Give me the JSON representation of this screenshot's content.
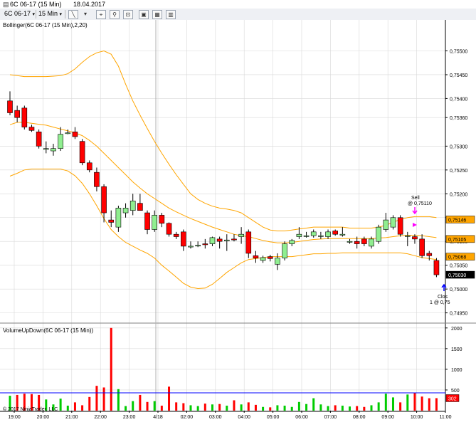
{
  "window": {
    "title": "6C 06-17 (15 Min)",
    "date": "18.04.2017"
  },
  "toolbar": {
    "instrument": "6C 06-17",
    "period": "15 Min"
  },
  "icons": [
    "chevron-down-icon",
    "draw-line-icon",
    "pointer-icon",
    "zoom-icon",
    "properties-icon",
    "data-box-icon",
    "indicators-icon",
    "strategies-icon"
  ],
  "colors": {
    "up": "#90ee90",
    "down": "#ff0000",
    "band": "#ffa500",
    "volume_line": "#0000ff",
    "grid": "#d8d8d8"
  },
  "chart_data": [
    {
      "type": "candlestick",
      "title": "Bollinger(6C 06-17 (15 Min),2,20)",
      "ylim": [
        0.7493,
        0.75565
      ],
      "y_ticks": [
        "0,75500",
        "0,75450",
        "0,75400",
        "0,75360",
        "0,75300",
        "0,75250",
        "0,75200",
        "0,75150",
        "0,75100",
        "0,75050",
        "0,75000",
        "0,74950"
      ],
      "y_tick_values": [
        0.755,
        0.7545,
        0.754,
        0.7536,
        0.753,
        0.7525,
        0.752,
        0.7515,
        0.751,
        0.7505,
        0.75,
        0.7495
      ],
      "x_ticks": [
        "19:00",
        "20:00",
        "21:00",
        "22:00",
        "23:00",
        "4/18",
        "02:00",
        "03:00",
        "04:00",
        "05:00",
        "06:00",
        "07:00",
        "08:00",
        "09:00",
        "10:00",
        "11:00"
      ],
      "candles": [
        {
          "o": 0.75395,
          "h": 0.75415,
          "l": 0.75365,
          "c": 0.7537
        },
        {
          "o": 0.75375,
          "h": 0.75385,
          "l": 0.7535,
          "c": 0.7536
        },
        {
          "o": 0.7538,
          "h": 0.75385,
          "l": 0.75335,
          "c": 0.7534
        },
        {
          "o": 0.7534,
          "h": 0.75345,
          "l": 0.7533,
          "c": 0.75333
        },
        {
          "o": 0.7533,
          "h": 0.75335,
          "l": 0.75295,
          "c": 0.753
        },
        {
          "o": 0.75295,
          "h": 0.7531,
          "l": 0.75285,
          "c": 0.75295
        },
        {
          "o": 0.7529,
          "h": 0.75305,
          "l": 0.7528,
          "c": 0.75295
        },
        {
          "o": 0.75295,
          "h": 0.7534,
          "l": 0.7529,
          "c": 0.75325
        },
        {
          "o": 0.75328,
          "h": 0.75335,
          "l": 0.75325,
          "c": 0.75328
        },
        {
          "o": 0.7533,
          "h": 0.7534,
          "l": 0.75315,
          "c": 0.7532
        },
        {
          "o": 0.7531,
          "h": 0.75315,
          "l": 0.7526,
          "c": 0.75265
        },
        {
          "o": 0.75265,
          "h": 0.7527,
          "l": 0.75245,
          "c": 0.7525
        },
        {
          "o": 0.75245,
          "h": 0.75255,
          "l": 0.75205,
          "c": 0.75215
        },
        {
          "o": 0.75215,
          "h": 0.7522,
          "l": 0.7514,
          "c": 0.7516
        },
        {
          "o": 0.75145,
          "h": 0.75165,
          "l": 0.7513,
          "c": 0.7514
        },
        {
          "o": 0.7513,
          "h": 0.75175,
          "l": 0.7512,
          "c": 0.7517
        },
        {
          "o": 0.7516,
          "h": 0.7518,
          "l": 0.7515,
          "c": 0.7517
        },
        {
          "o": 0.75165,
          "h": 0.752,
          "l": 0.75155,
          "c": 0.75185
        },
        {
          "o": 0.7518,
          "h": 0.752,
          "l": 0.75175,
          "c": 0.75165
        },
        {
          "o": 0.7516,
          "h": 0.75165,
          "l": 0.75115,
          "c": 0.75125
        },
        {
          "o": 0.75125,
          "h": 0.75165,
          "l": 0.7512,
          "c": 0.75155
        },
        {
          "o": 0.75155,
          "h": 0.7516,
          "l": 0.7513,
          "c": 0.75138
        },
        {
          "o": 0.75138,
          "h": 0.7514,
          "l": 0.7511,
          "c": 0.75115
        },
        {
          "o": 0.75115,
          "h": 0.7512,
          "l": 0.75105,
          "c": 0.7511
        },
        {
          "o": 0.7512,
          "h": 0.75125,
          "l": 0.7508,
          "c": 0.7509
        },
        {
          "o": 0.7509,
          "h": 0.751,
          "l": 0.75085,
          "c": 0.7509
        },
        {
          "o": 0.75092,
          "h": 0.751,
          "l": 0.75088,
          "c": 0.75092
        },
        {
          "o": 0.75095,
          "h": 0.75105,
          "l": 0.75085,
          "c": 0.75093
        },
        {
          "o": 0.75095,
          "h": 0.7511,
          "l": 0.7509,
          "c": 0.75108
        },
        {
          "o": 0.75105,
          "h": 0.7511,
          "l": 0.75085,
          "c": 0.751
        },
        {
          "o": 0.75103,
          "h": 0.75115,
          "l": 0.7508,
          "c": 0.75103
        },
        {
          "o": 0.75105,
          "h": 0.75115,
          "l": 0.751,
          "c": 0.75103
        },
        {
          "o": 0.7511,
          "h": 0.7513,
          "l": 0.75095,
          "c": 0.75115
        },
        {
          "o": 0.7512,
          "h": 0.75125,
          "l": 0.75065,
          "c": 0.75075
        },
        {
          "o": 0.7507,
          "h": 0.7508,
          "l": 0.75055,
          "c": 0.75065
        },
        {
          "o": 0.7506,
          "h": 0.7507,
          "l": 0.75055,
          "c": 0.75066
        },
        {
          "o": 0.75068,
          "h": 0.75072,
          "l": 0.75058,
          "c": 0.75064
        },
        {
          "o": 0.75052,
          "h": 0.75075,
          "l": 0.7504,
          "c": 0.75065
        },
        {
          "o": 0.75065,
          "h": 0.751,
          "l": 0.7506,
          "c": 0.75095
        },
        {
          "o": 0.75095,
          "h": 0.75105,
          "l": 0.7509,
          "c": 0.75102
        },
        {
          "o": 0.7511,
          "h": 0.7513,
          "l": 0.75105,
          "c": 0.75115
        },
        {
          "o": 0.75112,
          "h": 0.7512,
          "l": 0.75108,
          "c": 0.75112
        },
        {
          "o": 0.75112,
          "h": 0.75125,
          "l": 0.75108,
          "c": 0.7512
        },
        {
          "o": 0.75112,
          "h": 0.7512,
          "l": 0.75105,
          "c": 0.75112
        },
        {
          "o": 0.7511,
          "h": 0.75125,
          "l": 0.75105,
          "c": 0.7512
        },
        {
          "o": 0.75122,
          "h": 0.75125,
          "l": 0.75112,
          "c": 0.75115
        },
        {
          "o": 0.75115,
          "h": 0.7513,
          "l": 0.7511,
          "c": 0.75115
        },
        {
          "o": 0.751,
          "h": 0.75105,
          "l": 0.75095,
          "c": 0.751
        },
        {
          "o": 0.751,
          "h": 0.7511,
          "l": 0.75085,
          "c": 0.75095
        },
        {
          "o": 0.75105,
          "h": 0.7511,
          "l": 0.7509,
          "c": 0.75095
        },
        {
          "o": 0.7509,
          "h": 0.7511,
          "l": 0.75085,
          "c": 0.75105
        },
        {
          "o": 0.751,
          "h": 0.75135,
          "l": 0.75095,
          "c": 0.7513
        },
        {
          "o": 0.75125,
          "h": 0.7516,
          "l": 0.7512,
          "c": 0.75145
        },
        {
          "o": 0.7513,
          "h": 0.75155,
          "l": 0.75125,
          "c": 0.7515
        },
        {
          "o": 0.7515,
          "h": 0.75155,
          "l": 0.7511,
          "c": 0.75115
        },
        {
          "o": 0.75112,
          "h": 0.7512,
          "l": 0.7509,
          "c": 0.75112
        },
        {
          "o": 0.7511,
          "h": 0.75115,
          "l": 0.75095,
          "c": 0.75105
        },
        {
          "o": 0.75105,
          "h": 0.75115,
          "l": 0.75065,
          "c": 0.7507
        },
        {
          "o": 0.75075,
          "h": 0.7508,
          "l": 0.7506,
          "c": 0.7507
        },
        {
          "o": 0.7506,
          "h": 0.75065,
          "l": 0.75025,
          "c": 0.7503
        }
      ],
      "upper_band": [
        0.7545,
        0.75448,
        0.75446,
        0.75446,
        0.75446,
        0.75446,
        0.75447,
        0.75448,
        0.75452,
        0.75462,
        0.75476,
        0.75488,
        0.75496,
        0.755,
        0.75493,
        0.75468,
        0.7543,
        0.75395,
        0.75365,
        0.75337,
        0.7531,
        0.75285,
        0.75262,
        0.7524,
        0.7522,
        0.752,
        0.75188,
        0.7518,
        0.75174,
        0.7517,
        0.75168,
        0.75165,
        0.7516,
        0.7515,
        0.7514,
        0.7513,
        0.75124,
        0.75122,
        0.75122,
        0.75124,
        0.75126,
        0.75128,
        0.7513,
        0.7513,
        0.7513,
        0.7513,
        0.7513,
        0.75128,
        0.75128,
        0.75128,
        0.75128,
        0.7513,
        0.75134,
        0.7514,
        0.75146,
        0.7515,
        0.75152,
        0.75152,
        0.75152,
        0.7515
      ],
      "middle_band": [
        0.75345,
        0.7535,
        0.7535,
        0.75348,
        0.75346,
        0.75344,
        0.7534,
        0.75336,
        0.75332,
        0.75328,
        0.75322,
        0.75312,
        0.753,
        0.75285,
        0.7527,
        0.75255,
        0.7524,
        0.75225,
        0.75212,
        0.752,
        0.7519,
        0.7518,
        0.7517,
        0.75162,
        0.75155,
        0.75148,
        0.75142,
        0.75136,
        0.7513,
        0.75125,
        0.7512,
        0.75115,
        0.75112,
        0.7511,
        0.75106,
        0.75102,
        0.75099,
        0.75097,
        0.75097,
        0.75098,
        0.751,
        0.75102,
        0.75104,
        0.75105,
        0.75106,
        0.75106,
        0.75106,
        0.75106,
        0.75106,
        0.75106,
        0.75106,
        0.75107,
        0.75108,
        0.7511,
        0.75112,
        0.75113,
        0.75113,
        0.75112,
        0.7511,
        0.75108
      ],
      "lower_band": [
        0.75237,
        0.75243,
        0.7525,
        0.75252,
        0.75252,
        0.75252,
        0.75252,
        0.75252,
        0.75248,
        0.75238,
        0.75222,
        0.752,
        0.75175,
        0.75148,
        0.75125,
        0.7511,
        0.75098,
        0.7509,
        0.75082,
        0.75075,
        0.75065,
        0.7505,
        0.75038,
        0.75025,
        0.75012,
        0.75004,
        0.75001,
        0.75002,
        0.7501,
        0.75022,
        0.75035,
        0.75045,
        0.75055,
        0.75062,
        0.75064,
        0.75066,
        0.75068,
        0.75068,
        0.75068,
        0.75068,
        0.7507,
        0.75072,
        0.75074,
        0.75074,
        0.75075,
        0.75075,
        0.75076,
        0.75076,
        0.75076,
        0.75076,
        0.75076,
        0.75076,
        0.75076,
        0.75076,
        0.75076,
        0.75074,
        0.7507,
        0.75066,
        0.75064,
        0.75062
      ],
      "price_markers": [
        {
          "label": "0,75146",
          "value": 0.75146,
          "color": "#ffa500",
          "text_color": "#000000"
        },
        {
          "label": "0,75105",
          "value": 0.75105,
          "color": "#ffa500",
          "text_color": "#000000"
        },
        {
          "label": "0,75068",
          "value": 0.75068,
          "color": "#ffa500",
          "text_color": "#000000"
        },
        {
          "label": "0,75030",
          "value": 0.7503,
          "color": "#000000",
          "text_color": "#ffffff"
        }
      ],
      "annotations": {
        "sell_label": "Sell",
        "sell_price": "@ 0,75110",
        "close_label": "Clos",
        "close_qty": "1 @ 0,75"
      }
    },
    {
      "type": "bar",
      "title": "VolumeUpDown(6C 06-17 (15 Min))",
      "ylim": [
        0,
        2100
      ],
      "y_ticks": [
        "2000",
        "1500",
        "1000",
        "500"
      ],
      "y_tick_values": [
        2000,
        1500,
        1000,
        500
      ],
      "reference_line": 430,
      "last_value_label": "302",
      "last_value": 302,
      "volumes": [
        360,
        380,
        410,
        400,
        380,
        270,
        150,
        290,
        120,
        200,
        130,
        330,
        600,
        560,
        2000,
        520,
        110,
        230,
        380,
        210,
        230,
        120,
        580,
        200,
        180,
        130,
        110,
        170,
        150,
        160,
        120,
        250,
        150,
        200,
        140,
        90,
        80,
        130,
        120,
        90,
        210,
        160,
        300,
        150,
        110,
        130,
        120,
        100,
        110,
        90,
        130,
        200,
        410,
        320,
        200,
        390,
        430,
        340,
        300,
        302
      ]
    }
  ]
}
